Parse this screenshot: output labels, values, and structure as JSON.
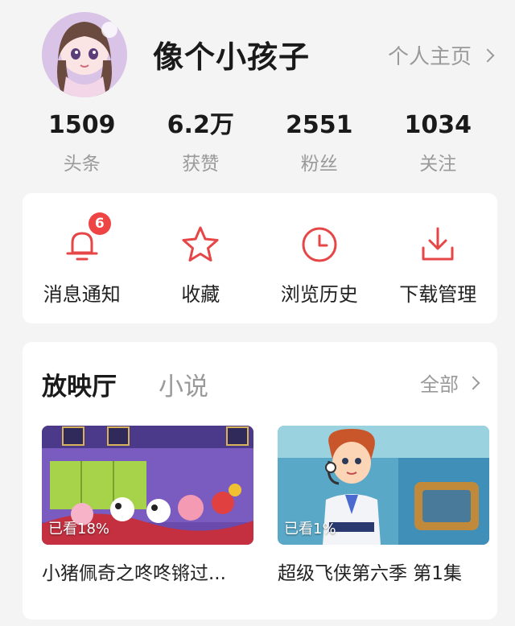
{
  "profile": {
    "username": "像个小孩子",
    "profile_link_label": "个人主页"
  },
  "stats": [
    {
      "value": "1509",
      "label": "头条"
    },
    {
      "value": "6.2万",
      "label": "获赞"
    },
    {
      "value": "2551",
      "label": "粉丝"
    },
    {
      "value": "1034",
      "label": "关注"
    }
  ],
  "actions": [
    {
      "label": "消息通知",
      "icon": "bell-icon",
      "badge": "6"
    },
    {
      "label": "收藏",
      "icon": "star-icon"
    },
    {
      "label": "浏览历史",
      "icon": "clock-icon"
    },
    {
      "label": "下载管理",
      "icon": "download-icon"
    }
  ],
  "cinema": {
    "tabs": [
      {
        "label": "放映厅",
        "active": true
      },
      {
        "label": "小说",
        "active": false
      }
    ],
    "all_label": "全部",
    "videos": [
      {
        "title": "小猪佩奇之咚咚锵过...",
        "progress_label": "已看18%",
        "watched_percent": 18
      },
      {
        "title": "超级飞侠第六季 第1集",
        "progress_label": "已看1%",
        "watched_percent": 1
      }
    ]
  },
  "colors": {
    "accent": "#e64646",
    "background": "#f4f4f4",
    "card": "#ffffff",
    "muted_text": "#9a9a9a"
  }
}
